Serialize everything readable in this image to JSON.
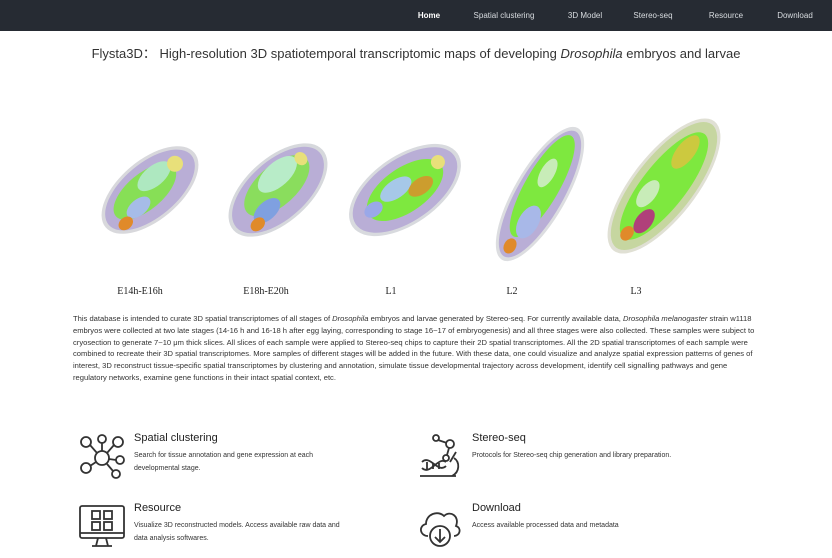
{
  "nav": {
    "items": [
      {
        "label": "Home",
        "active": true
      },
      {
        "label": "Spatial clustering",
        "active": false
      },
      {
        "label": "3D Model",
        "active": false
      },
      {
        "label": "Stereo-seq",
        "active": false
      },
      {
        "label": "Resource",
        "active": false
      },
      {
        "label": "Download",
        "active": false
      }
    ]
  },
  "title": {
    "prefix": "Flysta3D： High-resolution 3D spatiotemporal transcriptomic maps of developing ",
    "italic": "Drosophila",
    "suffix": " embryos and larvae"
  },
  "stages": [
    {
      "label": "E14h-E16h"
    },
    {
      "label": "E18h-E20h"
    },
    {
      "label": "L1"
    },
    {
      "label": "L2"
    },
    {
      "label": "L3"
    }
  ],
  "intro": {
    "p1_a": "This database is intended to curate 3D spatial transcriptomes of all stages of ",
    "p1_b": "Drosophila",
    "p1_c": " embryos and larvae generated by Stereo-seq. For currently available data, ",
    "p1_d": "Drosophila melanogaster",
    "p1_e": " strain w1118 embryos were collected at two late stages (14-16 h and 16-18 h after egg laying, corresponding to stage 16~17 of embryogenesis) and all three stages were also collected. These samples were subject to cryosection to generate 7~10 μm thick slices. All slices of each sample were applied to Stereo-seq chips to capture their 2D spatial transcriptomes. All the 2D spatial transcriptomes of each sample were combined to recreate their 3D spatial transcriptomes. More samples of different stages will be added in the future. With these data, one could visualize and analyze spatial expression patterns of genes of interest, 3D reconstruct tissue-specific spatial transcriptomes by clustering and annotation, simulate tissue developmental trajectory across development, identify cell signalling pathways and gene regulatory networks, examine gene functions in their intact spatial context, etc."
  },
  "features": [
    {
      "title": "Spatial clustering",
      "desc": "Search for tissue annotation and gene expression at each developmental stage.",
      "icon": "network-cluster-icon"
    },
    {
      "title": "Stereo-seq",
      "desc": "Protocols for Stereo-seq chip generation and library preparation.",
      "icon": "dna-microscope-icon"
    },
    {
      "title": "Resource",
      "desc": "Visualize 3D reconstructed models. Access available raw data and data analysis softwares.",
      "icon": "monitor-grid-icon"
    },
    {
      "title": "Download",
      "desc": "Access available processed data and metadata",
      "icon": "cloud-download-icon"
    }
  ],
  "colors": {
    "navbar": "#262b33",
    "embryo_green": "#7ee83f",
    "embryo_lavender": "#b9aed6",
    "embryo_orange": "#e08a2a"
  }
}
